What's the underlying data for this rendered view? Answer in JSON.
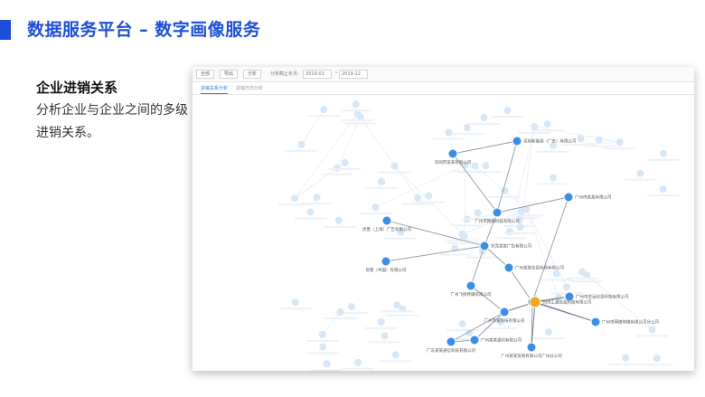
{
  "page": {
    "title": "数据服务平台 – 数字画像服务",
    "accent_color": "#1e4fd8"
  },
  "description": {
    "heading": "企业进销关系",
    "body": "分析企业与企业之间的多级进销关系。"
  },
  "app": {
    "toolbar": {
      "btn_all": "全部",
      "btn_export": "导出",
      "btn_analyze": "分析",
      "date_label": "分析截止年月：",
      "date_from": "2019-01",
      "date_sep": "~",
      "date_to": "2019-12"
    },
    "tabs": [
      {
        "label": "进销关系分析",
        "active": true
      },
      {
        "label": "进销方向分析"
      }
    ],
    "graph": {
      "node_color": "#3a8ee6",
      "highlight_color": "#f0a81c",
      "nodes": [
        {
          "id": "n1",
          "label": "深圳新能源（广东）有限公司"
        },
        {
          "id": "n2",
          "label": "深圳市某某有限公司"
        },
        {
          "id": "n3",
          "label": "广州市某某有限公司"
        },
        {
          "id": "n4",
          "label": "广州市网络科技有限公司"
        },
        {
          "id": "n5",
          "label": "优鲁（上海）广告有限公司"
        },
        {
          "id": "n6",
          "label": "东莞某某广告有限公司"
        },
        {
          "id": "n7",
          "label": "优鲁（中国）有限公司"
        },
        {
          "id": "n8",
          "label": "广州飞扬传媒有限公司"
        },
        {
          "id": "n9",
          "label": "广州某某信息科技有限公司"
        },
        {
          "id": "n10",
          "label": "广州市某科技有限公司"
        },
        {
          "id": "n11",
          "label": "广州市思远信息科技有限公司"
        },
        {
          "id": "n12",
          "label": "广州市网络传媒有限公司分公司"
        },
        {
          "id": "n13",
          "label": "广东某某通信科技有限公司"
        },
        {
          "id": "n14",
          "label": "广州某某通讯有限公司"
        },
        {
          "id": "n15",
          "label": "广州某某贸易有限公司广州分公司"
        },
        {
          "id": "n16",
          "label": "广州市汇通信息科技有限公司"
        }
      ]
    }
  }
}
